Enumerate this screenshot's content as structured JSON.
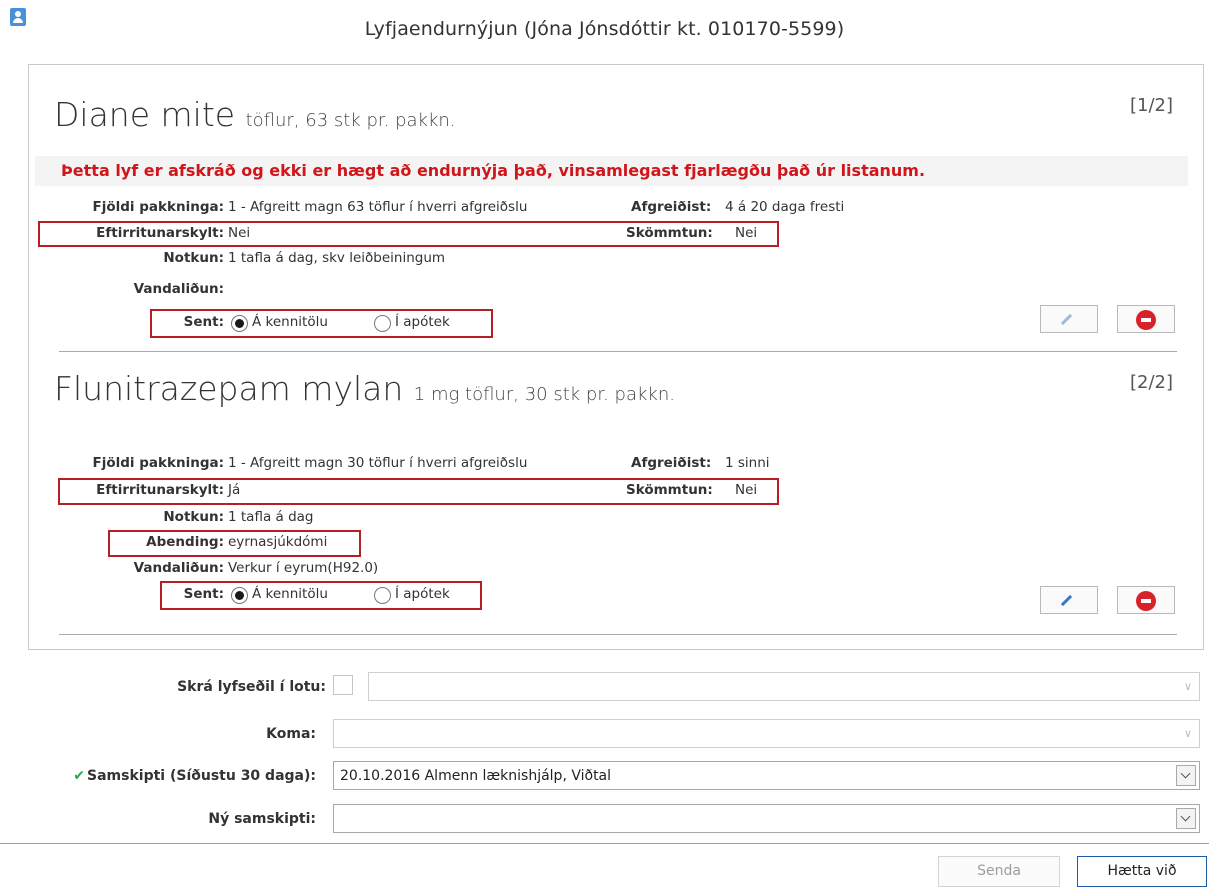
{
  "window": {
    "title": "Lyfjaendurnýjun (Jóna Jónsdóttir kt. 010170-5599)",
    "icon": "person-card-icon"
  },
  "drugs": [
    {
      "name": "Diane mite",
      "form": "töflur, 63 stk pr. pakkn.",
      "counter": "[1/2]",
      "warning": "Þetta lyf er afskráð og ekki er hægt að endurnýja það, vinsamlegast fjarlægðu það úr listanum.",
      "packages_label": "Fjöldi pakkninga:",
      "packages_value": "1 - Afgreitt magn 63 töflur í hverri afgreiðslu",
      "dispensed_label": "Afgreiðist:",
      "dispensed_value": "4 á 20 daga fresti",
      "monitoring_label": "Eftirritunarskylt:",
      "monitoring_value": "Nei",
      "dosing_label": "Skömmtun:",
      "dosing_value": "Nei",
      "usage_label": "Notkun:",
      "usage_value": "1 tafla á dag, skv leiðbeiningum",
      "problem_label": "Vandaliðun:",
      "problem_value": "",
      "sent_label": "Sent:",
      "sent_options": [
        "Á kennitölu",
        "Í apótek"
      ],
      "sent_selected": "Á kennitölu"
    },
    {
      "name": "Flunitrazepam mylan",
      "form": "1 mg töflur, 30 stk pr. pakkn.",
      "counter": "[2/2]",
      "packages_label": "Fjöldi pakkninga:",
      "packages_value": "1 - Afgreitt magn 30 töflur í hverri afgreiðslu",
      "dispensed_label": "Afgreiðist:",
      "dispensed_value": "1 sinni",
      "monitoring_label": "Eftirritunarskylt:",
      "monitoring_value": "Já",
      "dosing_label": "Skömmtun:",
      "dosing_value": "Nei",
      "usage_label": "Notkun:",
      "usage_value": "1 tafla á dag",
      "indication_label": "Abending:",
      "indication_value": "eyrnasjúkdómi",
      "problem_label": "Vandaliðun:",
      "problem_value": "Verkur í eyrum(H92.0)",
      "sent_label": "Sent:",
      "sent_options": [
        "Á kennitölu",
        "Í apótek"
      ],
      "sent_selected": "Á kennitölu"
    }
  ],
  "form": {
    "batch_label": "Skrá lyfseðil í lotu:",
    "batch_value": "",
    "arrival_label": "Koma:",
    "arrival_value": "",
    "contact_label": "Samskipti (Síðustu 30 daga):",
    "contact_value": "20.10.2016 Almenn læknishjálp, Viðtal",
    "new_contact_label": "Ný samskipti:",
    "new_contact_value": ""
  },
  "buttons": {
    "send": "Senda",
    "cancel": "Hætta við"
  },
  "colors": {
    "warning": "#d0161b",
    "highlight_box": "#b41e24",
    "remove": "#d8222a",
    "check": "#2aa84a",
    "primary_border": "#1f5aa8"
  }
}
